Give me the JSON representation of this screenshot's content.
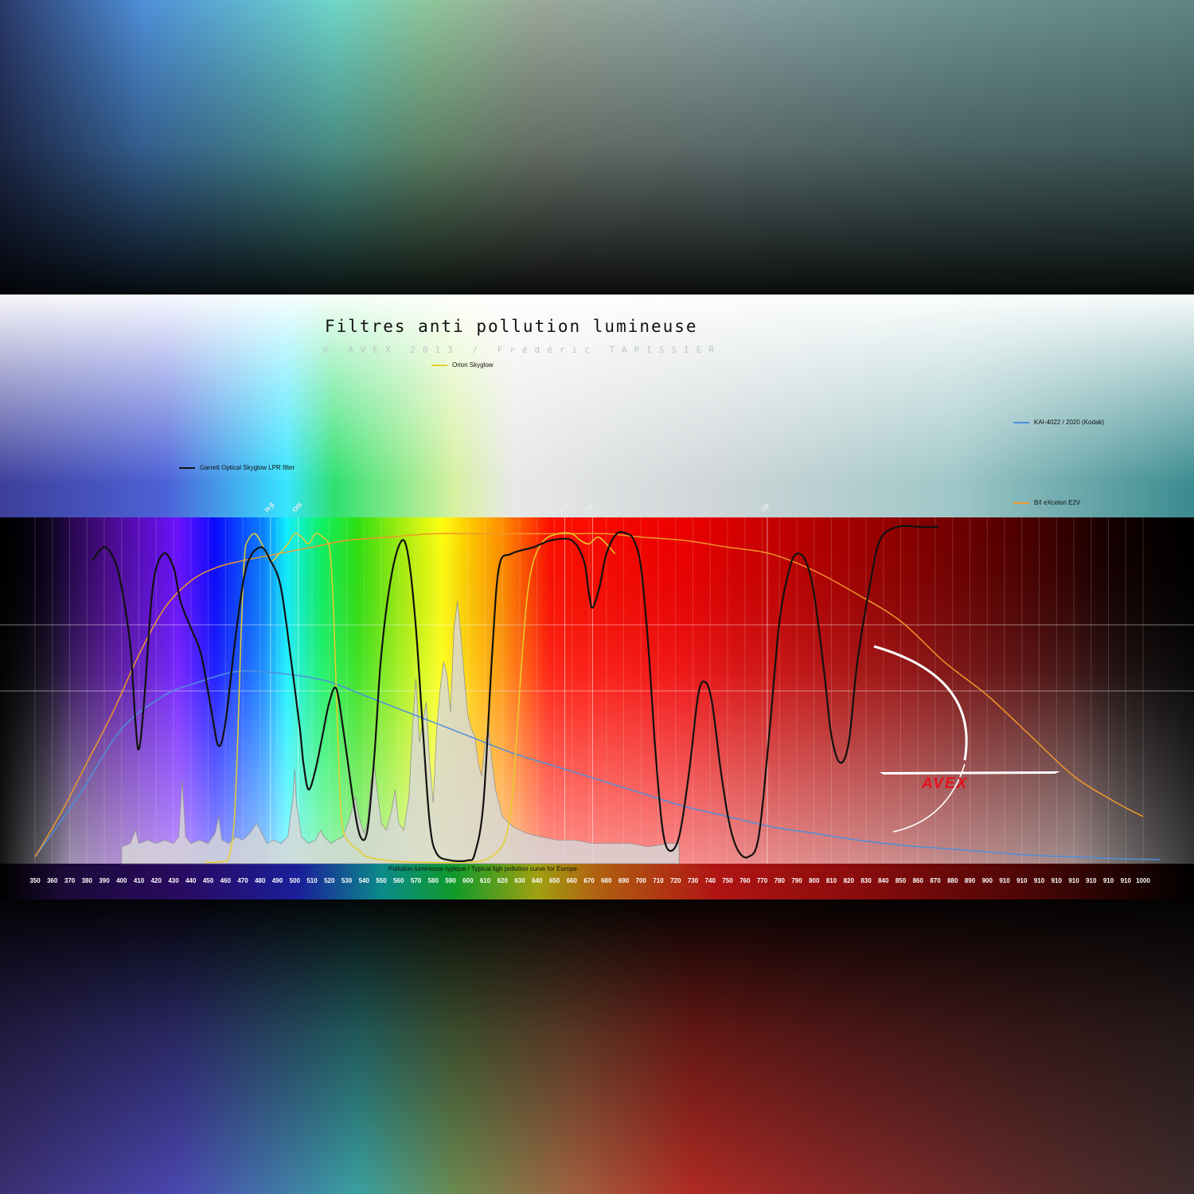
{
  "header": {
    "title": "Filtres anti pollution lumineuse",
    "credits": "© AVEX 2013 / Frédéric TAPISSIER"
  },
  "logo": {
    "text": "AVEX"
  },
  "chart_data": {
    "type": "line",
    "xlim": [
      350,
      1000
    ],
    "x_axis_label": "Pollution lumineuse typique / Typical ligh pollution curve for Europe",
    "ticks": [
      "350",
      "360",
      "370",
      "380",
      "390",
      "400",
      "410",
      "420",
      "430",
      "440",
      "450",
      "460",
      "470",
      "480",
      "490",
      "500",
      "510",
      "520",
      "530",
      "540",
      "550",
      "560",
      "570",
      "580",
      "590",
      "600",
      "610",
      "620",
      "630",
      "640",
      "650",
      "660",
      "670",
      "680",
      "690",
      "700",
      "710",
      "720",
      "730",
      "740",
      "750",
      "760",
      "770",
      "780",
      "790",
      "800",
      "810",
      "820",
      "830",
      "840",
      "850",
      "860",
      "870",
      "880",
      "890",
      "900",
      "910",
      "910",
      "910",
      "910",
      "910",
      "910",
      "910",
      "910",
      "1000"
    ],
    "emission_lines": [
      {
        "label": "H-β",
        "x": 486
      },
      {
        "label": "OIII",
        "x": 502
      },
      {
        "label": "H-α",
        "x": 656
      },
      {
        "label": "SII",
        "x": 672
      },
      {
        "label": "OII",
        "x": 773
      }
    ],
    "series": [
      {
        "name": "Garrett Optical Skyglow LPR filter",
        "color": "#111111",
        "points": [
          [
            383,
            90
          ],
          [
            390,
            94
          ],
          [
            396,
            90
          ],
          [
            400,
            82
          ],
          [
            405,
            65
          ],
          [
            408,
            42
          ],
          [
            410,
            34
          ],
          [
            413,
            48
          ],
          [
            418,
            82
          ],
          [
            424,
            92
          ],
          [
            430,
            88
          ],
          [
            434,
            78
          ],
          [
            440,
            70
          ],
          [
            446,
            62
          ],
          [
            452,
            45
          ],
          [
            456,
            35
          ],
          [
            460,
            42
          ],
          [
            466,
            68
          ],
          [
            472,
            88
          ],
          [
            480,
            94
          ],
          [
            486,
            90
          ],
          [
            492,
            82
          ],
          [
            498,
            60
          ],
          [
            503,
            40
          ],
          [
            505,
            30
          ],
          [
            508,
            22
          ],
          [
            512,
            28
          ],
          [
            516,
            38
          ],
          [
            520,
            48
          ],
          [
            524,
            52
          ],
          [
            528,
            40
          ],
          [
            534,
            18
          ],
          [
            538,
            8
          ],
          [
            542,
            10
          ],
          [
            546,
            32
          ],
          [
            550,
            62
          ],
          [
            556,
            86
          ],
          [
            562,
            96
          ],
          [
            566,
            90
          ],
          [
            570,
            70
          ],
          [
            574,
            40
          ],
          [
            578,
            12
          ],
          [
            582,
            3
          ],
          [
            590,
            1
          ],
          [
            600,
            1
          ],
          [
            604,
            3
          ],
          [
            609,
            18
          ],
          [
            614,
            62
          ],
          [
            618,
            88
          ],
          [
            625,
            92
          ],
          [
            638,
            94
          ],
          [
            648,
            96
          ],
          [
            660,
            96
          ],
          [
            667,
            90
          ],
          [
            670,
            80
          ],
          [
            672,
            76
          ],
          [
            676,
            82
          ],
          [
            680,
            92
          ],
          [
            686,
            98
          ],
          [
            692,
            98
          ],
          [
            696,
            96
          ],
          [
            700,
            88
          ],
          [
            704,
            66
          ],
          [
            708,
            36
          ],
          [
            712,
            12
          ],
          [
            716,
            4
          ],
          [
            722,
            8
          ],
          [
            728,
            28
          ],
          [
            733,
            50
          ],
          [
            737,
            54
          ],
          [
            741,
            48
          ],
          [
            746,
            28
          ],
          [
            751,
            12
          ],
          [
            756,
            4
          ],
          [
            762,
            2
          ],
          [
            768,
            8
          ],
          [
            774,
            38
          ],
          [
            780,
            72
          ],
          [
            786,
            88
          ],
          [
            790,
            92
          ],
          [
            795,
            90
          ],
          [
            800,
            80
          ],
          [
            806,
            56
          ],
          [
            810,
            38
          ],
          [
            815,
            30
          ],
          [
            820,
            36
          ],
          [
            825,
            60
          ],
          [
            832,
            82
          ],
          [
            838,
            96
          ],
          [
            848,
            100
          ],
          [
            862,
            100
          ],
          [
            872,
            100
          ]
        ]
      },
      {
        "name": "Orion Skyglow",
        "color": "#e6cf2a",
        "points": [
          [
            448,
            0.4
          ],
          [
            458,
            0.6
          ],
          [
            462,
            2
          ],
          [
            465,
            12
          ],
          [
            467,
            36
          ],
          [
            469,
            68
          ],
          [
            471,
            91
          ],
          [
            473,
            96
          ],
          [
            477,
            98
          ],
          [
            481,
            95
          ],
          [
            486,
            90
          ],
          [
            491,
            92
          ],
          [
            496,
            95
          ],
          [
            500,
            98
          ],
          [
            504,
            97
          ],
          [
            508,
            95
          ],
          [
            512,
            98
          ],
          [
            516,
            97
          ],
          [
            520,
            94
          ],
          [
            522,
            80
          ],
          [
            524,
            52
          ],
          [
            526,
            22
          ],
          [
            528,
            10
          ],
          [
            532,
            6
          ],
          [
            537,
            4
          ],
          [
            542,
            2
          ],
          [
            556,
            0.8
          ],
          [
            571,
            0.4
          ],
          [
            596,
            0.4
          ],
          [
            608,
            0.8
          ],
          [
            616,
            3
          ],
          [
            622,
            8
          ],
          [
            626,
            22
          ],
          [
            630,
            52
          ],
          [
            634,
            78
          ],
          [
            638,
            90
          ],
          [
            644,
            96
          ],
          [
            652,
            98
          ],
          [
            660,
            98
          ],
          [
            665,
            96
          ],
          [
            670,
            95
          ],
          [
            675,
            97
          ],
          [
            680,
            95
          ],
          [
            685,
            92
          ]
        ]
      },
      {
        "name": "KAI-4022 / 2020 (Kodak)",
        "color": "#4f8fda",
        "points": [
          [
            350,
            2
          ],
          [
            375,
            20
          ],
          [
            400,
            40
          ],
          [
            425,
            50
          ],
          [
            445,
            54
          ],
          [
            465,
            57
          ],
          [
            480,
            57
          ],
          [
            500,
            56
          ],
          [
            520,
            54
          ],
          [
            540,
            50
          ],
          [
            560,
            46
          ],
          [
            580,
            42
          ],
          [
            600,
            38
          ],
          [
            625,
            33
          ],
          [
            650,
            29
          ],
          [
            675,
            25
          ],
          [
            700,
            21
          ],
          [
            725,
            17
          ],
          [
            750,
            14
          ],
          [
            775,
            11
          ],
          [
            800,
            9
          ],
          [
            825,
            7
          ],
          [
            850,
            5.5
          ],
          [
            875,
            4.5
          ],
          [
            900,
            3.5
          ],
          [
            925,
            2.5
          ],
          [
            950,
            2
          ],
          [
            975,
            1.5
          ],
          [
            1000,
            1.2
          ]
        ]
      },
      {
        "name": "B/I eXcelon E2V",
        "color": "#f0982a",
        "points": [
          [
            350,
            2
          ],
          [
            365,
            15
          ],
          [
            380,
            30
          ],
          [
            395,
            45
          ],
          [
            410,
            62
          ],
          [
            425,
            76
          ],
          [
            440,
            84
          ],
          [
            455,
            88
          ],
          [
            470,
            90
          ],
          [
            490,
            92
          ],
          [
            510,
            94
          ],
          [
            530,
            96
          ],
          [
            555,
            97
          ],
          [
            580,
            98
          ],
          [
            605,
            98
          ],
          [
            630,
            98
          ],
          [
            655,
            98
          ],
          [
            680,
            98
          ],
          [
            700,
            97
          ],
          [
            725,
            96
          ],
          [
            750,
            94
          ],
          [
            775,
            92
          ],
          [
            800,
            87
          ],
          [
            825,
            80
          ],
          [
            850,
            72
          ],
          [
            875,
            60
          ],
          [
            900,
            50
          ],
          [
            925,
            38
          ],
          [
            950,
            26
          ],
          [
            975,
            18
          ],
          [
            990,
            14
          ]
        ]
      }
    ],
    "pollution_curve": {
      "name": "Pollution lumineuse typique / Typical ligh pollution curve for Europe",
      "points": [
        [
          400,
          5
        ],
        [
          405,
          6
        ],
        [
          408,
          10
        ],
        [
          410,
          6
        ],
        [
          415,
          7
        ],
        [
          420,
          6
        ],
        [
          425,
          7
        ],
        [
          430,
          6
        ],
        [
          433,
          8
        ],
        [
          435,
          25
        ],
        [
          437,
          8
        ],
        [
          440,
          6
        ],
        [
          445,
          7
        ],
        [
          450,
          6
        ],
        [
          454,
          9
        ],
        [
          456,
          14
        ],
        [
          458,
          7
        ],
        [
          462,
          6
        ],
        [
          466,
          8
        ],
        [
          470,
          7
        ],
        [
          474,
          9
        ],
        [
          478,
          12
        ],
        [
          480,
          10
        ],
        [
          484,
          6
        ],
        [
          488,
          7
        ],
        [
          492,
          6
        ],
        [
          496,
          8
        ],
        [
          499,
          20
        ],
        [
          500,
          28
        ],
        [
          501,
          18
        ],
        [
          504,
          8
        ],
        [
          508,
          6
        ],
        [
          512,
          7
        ],
        [
          515,
          10
        ],
        [
          517,
          8
        ],
        [
          521,
          6
        ],
        [
          524,
          7
        ],
        [
          528,
          8
        ],
        [
          532,
          14
        ],
        [
          535,
          20
        ],
        [
          537,
          14
        ],
        [
          540,
          9
        ],
        [
          542,
          12
        ],
        [
          544,
          24
        ],
        [
          546,
          30
        ],
        [
          547,
          24
        ],
        [
          550,
          12
        ],
        [
          553,
          10
        ],
        [
          556,
          16
        ],
        [
          558,
          22
        ],
        [
          560,
          12
        ],
        [
          563,
          10
        ],
        [
          566,
          20
        ],
        [
          568,
          40
        ],
        [
          570,
          55
        ],
        [
          572,
          36
        ],
        [
          574,
          42
        ],
        [
          576,
          48
        ],
        [
          578,
          30
        ],
        [
          580,
          18
        ],
        [
          582,
          40
        ],
        [
          584,
          52
        ],
        [
          586,
          60
        ],
        [
          588,
          56
        ],
        [
          590,
          45
        ],
        [
          592,
          70
        ],
        [
          594,
          78
        ],
        [
          596,
          68
        ],
        [
          598,
          55
        ],
        [
          600,
          44
        ],
        [
          602,
          40
        ],
        [
          604,
          38
        ],
        [
          606,
          30
        ],
        [
          608,
          26
        ],
        [
          610,
          36
        ],
        [
          612,
          40
        ],
        [
          614,
          30
        ],
        [
          616,
          22
        ],
        [
          620,
          14
        ],
        [
          626,
          11
        ],
        [
          634,
          9
        ],
        [
          642,
          8
        ],
        [
          652,
          7
        ],
        [
          662,
          7
        ],
        [
          672,
          6
        ],
        [
          682,
          6
        ],
        [
          694,
          6
        ],
        [
          704,
          5
        ],
        [
          716,
          6
        ],
        [
          722,
          6
        ]
      ]
    }
  },
  "legend": {
    "garrett": "Garrett Optical Skyglow LPR filter",
    "orion": "Orion Skyglow",
    "kodak": "KAI-4022 / 2020 (Kodak)",
    "e2v": "B/I eXcelon E2V"
  },
  "colors": {
    "garrett": "#111111",
    "orion": "#e6cf2a",
    "kodak": "#4f8fda",
    "e2v": "#f0982a",
    "logo": "#e3111a"
  }
}
